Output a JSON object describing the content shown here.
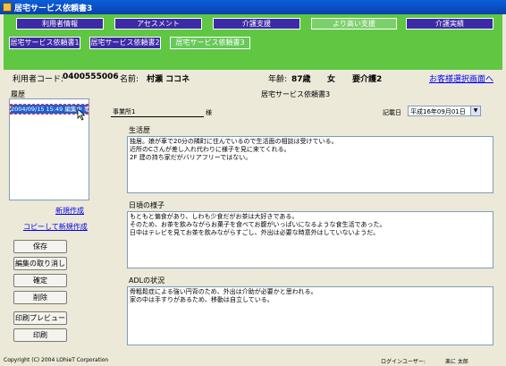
{
  "window": {
    "title": "居宅サービス依頼書3"
  },
  "main_tabs": [
    {
      "label": "利用者情報",
      "active": false
    },
    {
      "label": "アセスメント",
      "active": false
    },
    {
      "label": "介護支援",
      "active": false
    },
    {
      "label": "より高い支援",
      "active": true
    },
    {
      "label": "介護実績",
      "active": false
    }
  ],
  "sub_tabs": [
    {
      "label": "居宅サービス依頼書1",
      "active": false
    },
    {
      "label": "居宅サービス依頼書2",
      "active": false
    },
    {
      "label": "居宅サービス依頼書3",
      "active": true
    }
  ],
  "info": {
    "user_code_label": "利用者コード:",
    "user_code": "0400555006",
    "name_label": "名前:",
    "name": "村瀬 ココネ",
    "age_label": "年齢:",
    "age": "87歳",
    "sex": "女",
    "care_level": "要介護2",
    "customer_select_link": "お客様選択画面へ"
  },
  "history": {
    "label": "履歴",
    "items": [
      "2004/09/15 15:49 編集中 事業者"
    ]
  },
  "left_links": {
    "new": "新規作成",
    "copy_new": "コピーして新規作成"
  },
  "left_buttons": {
    "save": "保存",
    "cancel_edit": "編集の取り消し",
    "confirm": "確定",
    "delete": "削除",
    "print_preview": "印刷プレビュー",
    "print": "印刷"
  },
  "form": {
    "page_title": "居宅サービス依頼書3",
    "office_name": "事業所1",
    "honorific": "様",
    "date_label": "記載日",
    "date_value": "平成16年09月01日",
    "life_history_label": "生活歴",
    "life_history_text": "独居。娘が車で20分の隣町に住んでいるので生活面の相談は受けている。\n近所のCさんが差し入れ代わりに様子を見に来てくれる。\n2F 建の持ち家だがバリアフリーではない。",
    "daily_life_label": "日頃の様子",
    "daily_life_text": "もともと偏食があり、しわも少食だがお茶は大好きである。\nそのため、お茶を飲みながらお菓子を食べてお腹がいっぱいになるような食生活であった。\n日中はテレビを見てお茶を飲みながらすごし、外出は必要な時意外はしていないようだ。",
    "adl_label": "ADLの状況",
    "adl_text": "骨粗鬆症による強い円背のため、外出は介助が必要かと思われる。\n家の中は手すりがあるため、移動は自立している。"
  },
  "footer": {
    "copyright": "Copyright (C) 2004 LOhieT Corporation",
    "login_label": "ログインユーザー:",
    "login_user": "楽に 太郎"
  },
  "colors": {
    "titlebar": "#0b4fc8",
    "header_green": "#5fc742",
    "tab_blue": "#3c2aa6",
    "tab_active": "#7cd06c",
    "panel": "#ece9d8"
  }
}
